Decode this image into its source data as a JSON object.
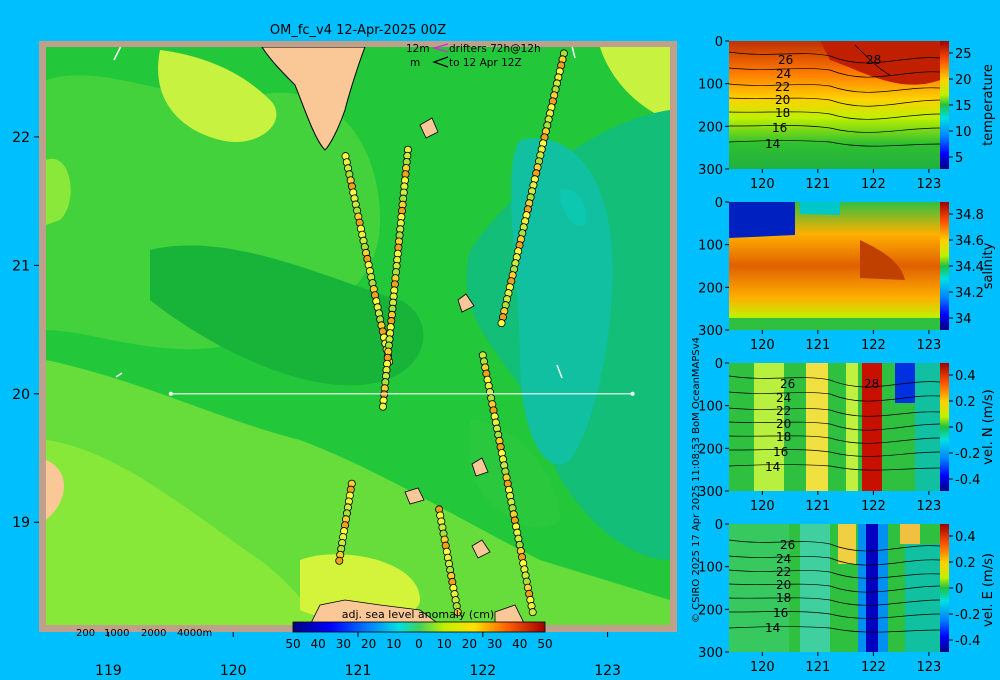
{
  "chart_data": [
    {
      "type": "heatmap",
      "title": "OM_fc_v4  12-Apr-2025 00Z",
      "x_ticks": [
        "119",
        "120",
        "121",
        "122",
        "123"
      ],
      "y_ticks": [
        "22",
        "21",
        "20",
        "19"
      ],
      "xlim": [
        118.5,
        123.5
      ],
      "ylim": [
        18.2,
        22.7
      ],
      "legend": {
        "line1": "12m",
        "line1b": "drifters 72h@12h",
        "line2": "m",
        "line2b": "to 12 Apr 12Z"
      },
      "depth_legend": [
        "200",
        "1000",
        "2000",
        "4000m"
      ],
      "colorbar": {
        "label": "adj. sea level anomaly (cm)",
        "ticks": [
          "50",
          "40",
          "30",
          "20",
          "10",
          "0",
          "10",
          "20",
          "30",
          "40",
          "50"
        ]
      },
      "transect_lat": 20.0,
      "transect_lon": [
        119.5,
        123.2
      ],
      "drifters": [
        {
          "from": [
            120.9,
            21.85
          ],
          "to": [
            121.25,
            20.25
          ]
        },
        {
          "from": [
            121.4,
            21.9
          ],
          "to": [
            121.2,
            19.9
          ]
        },
        {
          "from": [
            122.0,
            20.3
          ],
          "to": [
            122.4,
            18.3
          ]
        },
        {
          "from": [
            122.65,
            22.65
          ],
          "to": [
            122.15,
            20.55
          ]
        },
        {
          "from": [
            120.95,
            19.3
          ],
          "to": [
            120.85,
            18.7
          ]
        },
        {
          "from": [
            121.65,
            19.1
          ],
          "to": [
            121.8,
            18.3
          ]
        }
      ]
    },
    {
      "type": "heatmap",
      "colorbar_label": "temperature",
      "x_ticks": [
        "120",
        "121",
        "122",
        "123"
      ],
      "y_ticks": [
        "0",
        "100",
        "200",
        "300"
      ],
      "cbar_ticks": [
        "25",
        "20",
        "15",
        "10",
        "5"
      ],
      "contour_labels": [
        "26",
        "24",
        "22",
        "20",
        "18",
        "16",
        "14",
        "28"
      ]
    },
    {
      "type": "heatmap",
      "colorbar_label": "salinity",
      "x_ticks": [
        "120",
        "121",
        "122",
        "123"
      ],
      "y_ticks": [
        "0",
        "100",
        "200",
        "300"
      ],
      "cbar_ticks": [
        "34.8",
        "34.6",
        "34.4",
        "34.2",
        "34"
      ]
    },
    {
      "type": "heatmap",
      "colorbar_label": "vel. N (m/s)",
      "x_ticks": [
        "120",
        "121",
        "122",
        "123"
      ],
      "y_ticks": [
        "0",
        "100",
        "200",
        "300"
      ],
      "cbar_ticks": [
        "0.4",
        "0.2",
        "0",
        "-0.2",
        "-0.4"
      ],
      "contour_labels": [
        "26",
        "24",
        "22",
        "20",
        "18",
        "16",
        "14",
        "28"
      ]
    },
    {
      "type": "heatmap",
      "colorbar_label": "vel. E (m/s)",
      "x_ticks": [
        "120",
        "121",
        "122",
        "123"
      ],
      "y_ticks": [
        "0",
        "100",
        "200",
        "300"
      ],
      "cbar_ticks": [
        "0.4",
        "0.2",
        "0",
        "-0.2",
        "-0.4"
      ],
      "contour_labels": [
        "26",
        "24",
        "22",
        "20",
        "18",
        "16",
        "14"
      ]
    }
  ],
  "credit": "© CSIRO 2025   17 Apr 2025 11:08:53 BoM OceanMAPSv4",
  "colors": {
    "background": "#00bfff",
    "land": "#f9c896"
  }
}
